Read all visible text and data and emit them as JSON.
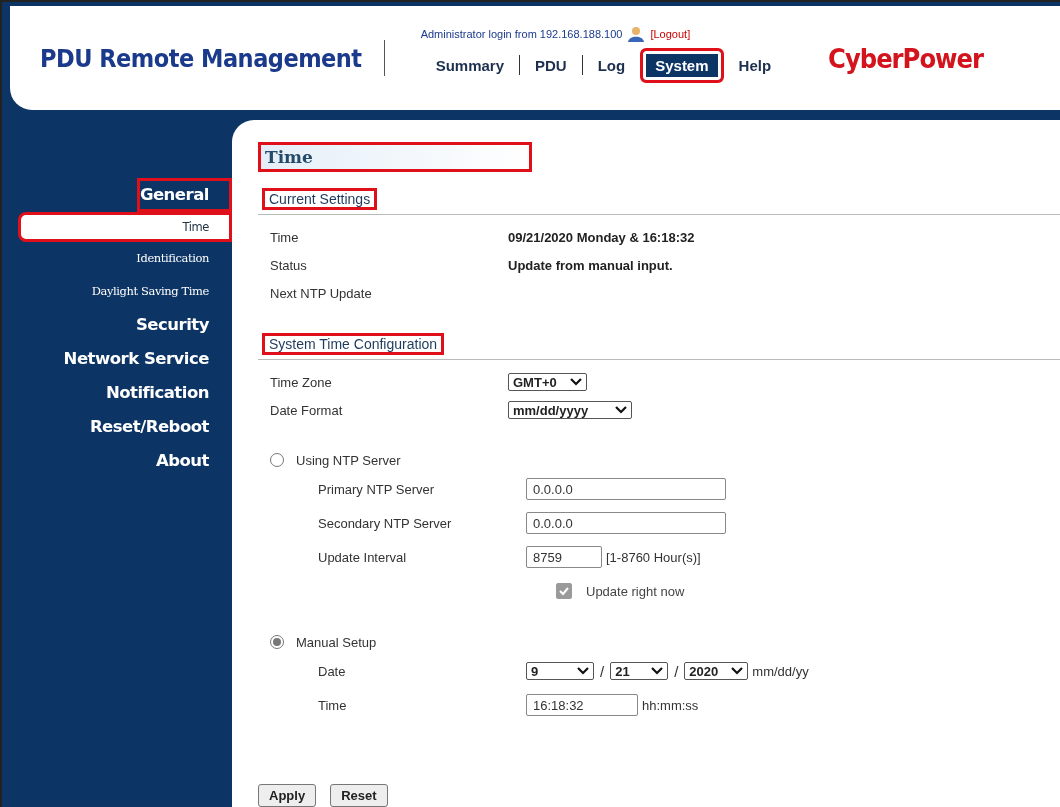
{
  "header": {
    "title": "PDU Remote Management",
    "login_text": "Administrator login from 192.168.188.100",
    "logout": "[Logout]",
    "brand": "CyberPower",
    "nav": [
      {
        "label": "Summary",
        "selected": false,
        "highlighted": false
      },
      {
        "label": "PDU",
        "selected": false,
        "highlighted": false
      },
      {
        "label": "Log",
        "selected": false,
        "highlighted": false
      },
      {
        "label": "System",
        "selected": true,
        "highlighted": true
      },
      {
        "label": "Help",
        "selected": false,
        "highlighted": false
      }
    ]
  },
  "sidebar": {
    "groups": [
      {
        "label": "General",
        "highlighted": true,
        "children": [
          {
            "label": "Time",
            "selected": true,
            "highlighted": true
          },
          {
            "label": "Identification",
            "selected": false,
            "highlighted": false
          },
          {
            "label": "Daylight Saving Time",
            "selected": false,
            "highlighted": false
          }
        ]
      },
      {
        "label": "Security",
        "highlighted": false
      },
      {
        "label": "Network Service",
        "highlighted": false
      },
      {
        "label": "Notification",
        "highlighted": false
      },
      {
        "label": "Reset/Reboot",
        "highlighted": false
      },
      {
        "label": "About",
        "highlighted": false
      }
    ]
  },
  "page": {
    "title": "Time",
    "title_highlighted": true,
    "sections": [
      {
        "heading": "Current Settings",
        "highlighted": true,
        "rows": [
          {
            "kind": "text",
            "label": "Time",
            "value": "09/21/2020 Monday & 16:18:32"
          },
          {
            "kind": "text",
            "label": "Status",
            "value": "Update from manual input."
          },
          {
            "kind": "text",
            "label": "Next NTP Update"
          }
        ]
      },
      {
        "heading": "System Time Configuration",
        "highlighted": true,
        "rows": [
          {
            "kind": "select",
            "label": "Time Zone",
            "value": "GMT+0"
          },
          {
            "kind": "select",
            "label": "Date Format",
            "value": "mm/dd/yyyy"
          }
        ]
      }
    ],
    "modes": [
      {
        "label": "Using NTP Server",
        "selected": false,
        "fields": [
          {
            "kind": "input",
            "label": "Primary NTP Server",
            "value": "0.0.0.0"
          },
          {
            "kind": "input",
            "label": "Secondary NTP Server",
            "value": "0.0.0.0"
          },
          {
            "kind": "input",
            "label": "Update Interval",
            "value": "8759",
            "hint": "[1-8760 Hour(s)]"
          },
          {
            "kind": "checkbox",
            "label": "Update right now",
            "checked": true,
            "disabled": true
          }
        ]
      },
      {
        "label": "Manual Setup",
        "selected": true,
        "fields": [
          {
            "kind": "date",
            "label": "Date",
            "parts": [
              {
                "value": "9"
              },
              {
                "separator": "/",
                "value": "21"
              },
              {
                "separator": "/",
                "value": "2020"
              }
            ],
            "hint": "mm/dd/yy"
          },
          {
            "kind": "input",
            "label": "Time",
            "value": "16:18:32",
            "hint": "hh:mm:ss"
          }
        ]
      }
    ],
    "buttons": [
      "Apply",
      "Reset"
    ]
  }
}
